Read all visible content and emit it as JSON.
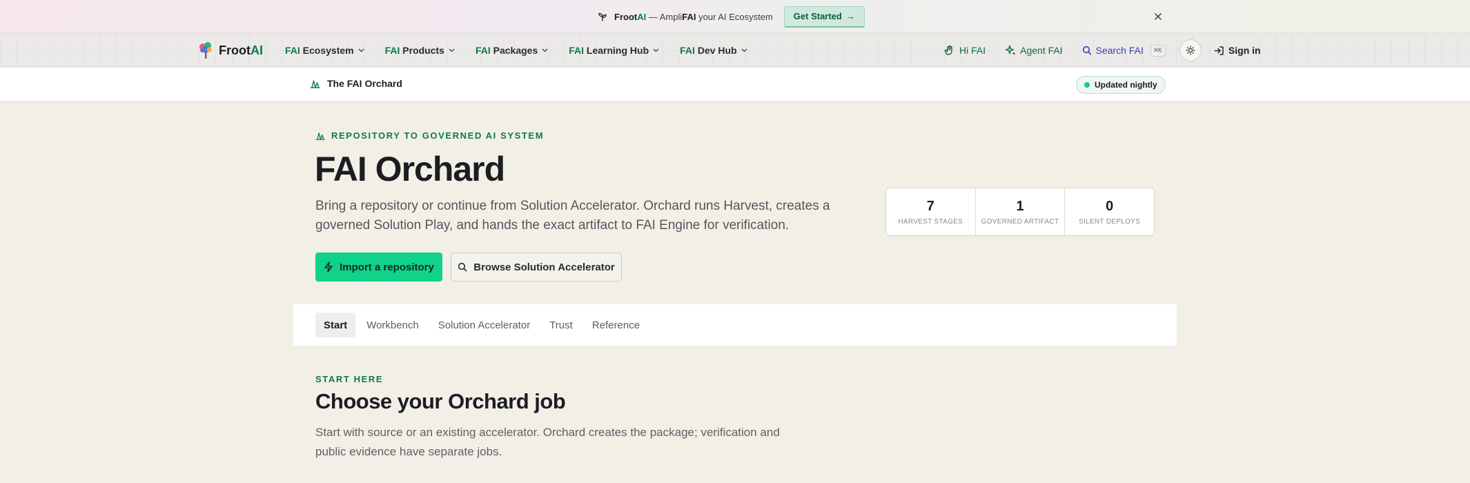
{
  "announcement": {
    "brand_prefix": "Froot",
    "brand_suffix": "AI",
    "dash": "—",
    "ampli": "Ampli",
    "fai": "FAI",
    "tagline_rest": "your AI Ecosystem",
    "cta_label": "Get Started",
    "cta_arrow": "→"
  },
  "nav": {
    "logo_prefix": "Froot",
    "logo_suffix": "AI",
    "menu": [
      {
        "fai": "FAI",
        "rest": "Ecosystem"
      },
      {
        "fai": "FAI",
        "rest": "Products"
      },
      {
        "fai": "FAI",
        "rest": "Packages"
      },
      {
        "fai": "FAI",
        "rest": "Learning Hub"
      },
      {
        "fai": "FAI",
        "rest": "Dev Hub"
      }
    ],
    "hi_label": "Hi FAI",
    "agent_label": "Agent FAI",
    "search_label": "Search FAI",
    "search_shortcut": "⌘K",
    "signin_label": "Sign in"
  },
  "subheader": {
    "title": "The FAI Orchard",
    "badge": "Updated nightly"
  },
  "hero": {
    "eyebrow": "REPOSITORY TO GOVERNED AI SYSTEM",
    "title": "FAI Orchard",
    "description": "Bring a repository or continue from Solution Accelerator. Orchard runs Harvest, creates a governed Solution Play, and hands the exact artifact to FAI Engine for verification.",
    "primary_button": "Import a repository",
    "secondary_button": "Browse Solution Accelerator"
  },
  "stats": [
    {
      "value": "7",
      "label": "HARVEST STAGES"
    },
    {
      "value": "1",
      "label": "GOVERNED ARTIFACT"
    },
    {
      "value": "0",
      "label": "SILENT DEPLOYS"
    }
  ],
  "tabs": [
    {
      "label": "Start",
      "active": true
    },
    {
      "label": "Workbench",
      "active": false
    },
    {
      "label": "Solution Accelerator",
      "active": false
    },
    {
      "label": "Trust",
      "active": false
    },
    {
      "label": "Reference",
      "active": false
    }
  ],
  "section": {
    "eyebrow": "START HERE",
    "title": "Choose your Orchard job",
    "description": "Start with source or an existing accelerator. Orchard creates the package; verification and public evidence have separate jobs."
  },
  "colors": {
    "brand_green": "#0d7a4a",
    "primary_button": "#10d28a",
    "search_accent": "#3b3fb5",
    "page_background": "#f2efe7"
  }
}
